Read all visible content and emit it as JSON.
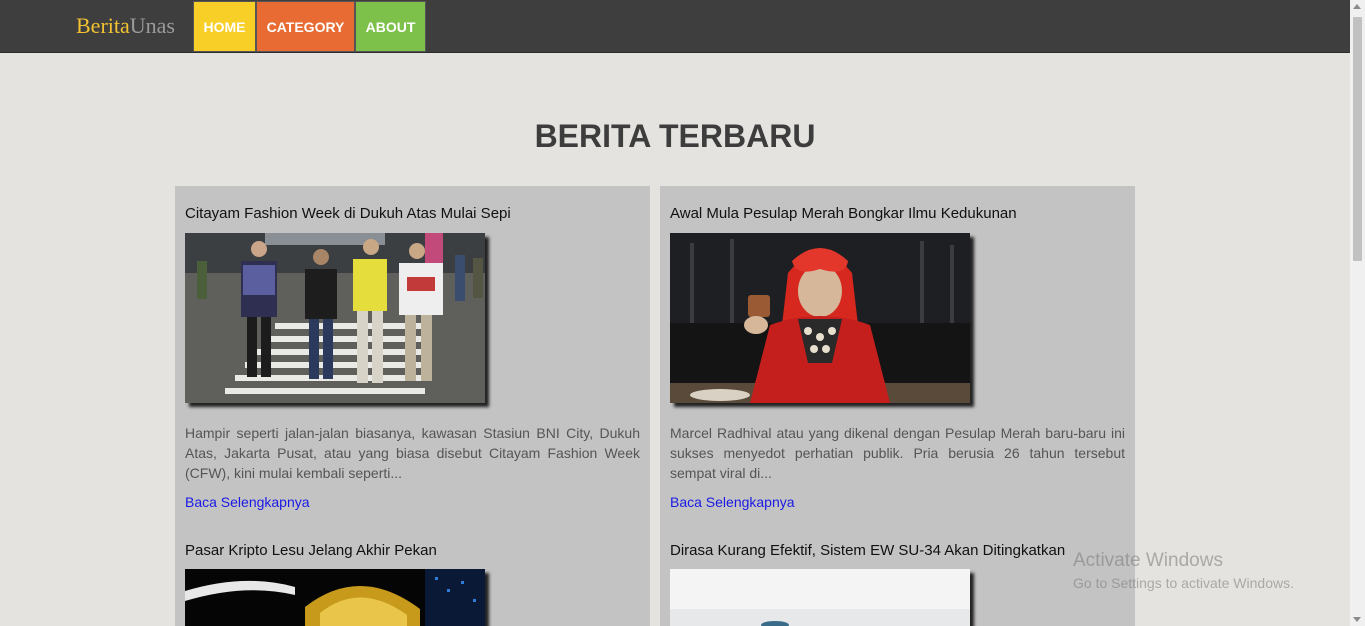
{
  "brand": {
    "part1": "Berita",
    "part2": "Unas"
  },
  "nav": {
    "home": "HOME",
    "category": "CATEGORY",
    "about": "ABOUT"
  },
  "heading": "BERITA TERBARU",
  "articles": [
    {
      "title": "Citayam Fashion Week di Dukuh Atas Mulai Sepi",
      "excerpt": "Hampir seperti jalan-jalan biasanya, kawasan Stasiun BNI City, Dukuh Atas, Jakarta Pusat, atau yang biasa disebut Citayam Fashion Week (CFW), kini mulai kembali seperti...",
      "link": "Baca Selengkapnya"
    },
    {
      "title": "Awal Mula Pesulap Merah Bongkar Ilmu Kedukunan",
      "excerpt": "Marcel Radhival atau yang dikenal dengan Pesulap Merah baru-baru ini sukses menyedot perhatian publik. Pria berusia 26 tahun tersebut sempat viral di...",
      "link": "Baca Selengkapnya"
    },
    {
      "title": "Pasar Kripto Lesu Jelang Akhir Pekan"
    },
    {
      "title": "Dirasa Kurang Efektif, Sistem EW SU-34 Akan Ditingkatkan"
    }
  ],
  "watermark": {
    "line1": "Activate Windows",
    "line2": "Go to Settings to activate Windows."
  },
  "colors": {
    "topbar": "#3e3e3e",
    "home": "#f7cf27",
    "category": "#e76b32",
    "about": "#7dc04a",
    "card": "#c4c3c3",
    "link": "#1a1ae6"
  }
}
